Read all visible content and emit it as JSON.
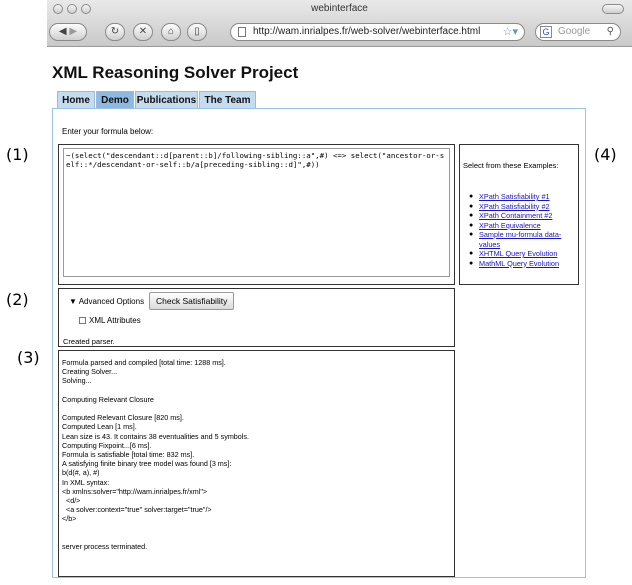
{
  "browser": {
    "window_title": "webinterface",
    "url": "http://wam.inrialpes.fr/web-solver/webinterface.html",
    "search_placeholder": "Google",
    "icons": [
      "back-icon",
      "forward-icon",
      "reload-icon",
      "stop-icon",
      "home-icon",
      "page-icon",
      "bookmark-star-icon",
      "search-engine-icon",
      "magnifier-icon",
      "extension-icon"
    ]
  },
  "page": {
    "title": "XML Reasoning Solver Project",
    "tabs": [
      {
        "label": "Home",
        "active": false
      },
      {
        "label": "Demo",
        "active": true
      },
      {
        "label": "Publications",
        "active": false
      },
      {
        "label": "The Team",
        "active": false
      }
    ]
  },
  "formula": {
    "prompt": "Enter your formula below:",
    "value": "~(select(\"descendant::d[parent::b]/following-sibling::a\",#) <=> select(\"ancestor-or-self::*/descendant-or-self::b/a[preceding-sibling::d]\",#))"
  },
  "examples": {
    "heading": "Select from these Examples:",
    "items": [
      "XPath Satisfiability #1",
      "XPath Satisfiability #2",
      "XPath Containment #2",
      "XPath Equivalence",
      "Sample mu-formula data-values",
      "XHTML Query Evolution",
      "MathML Query Evolution"
    ]
  },
  "controls": {
    "advanced_label": "Advanced Options",
    "check_button": "Check Satisfiability",
    "xml_attributes_label": "XML Attributes",
    "status": "Created parser."
  },
  "output": {
    "lines": [
      "Formula parsed and compiled [total time: 1288 ms].",
      "Creating Solver...",
      "Solving...",
      "",
      "Computing Relevant Closure",
      "",
      "Computed Relevant Closure [820 ms].",
      "Computed Lean [1 ms].",
      "Lean size is 43. It contains 38 eventualities and 5 symbols.",
      "Computing Fixpoint...[6 ms].",
      "Formula is satisfiable [total time: 832 ms].",
      "A satisfying finite binary tree model was found [3 ms]:",
      "b(d(#, a), #)",
      "In XML syntax:",
      "<b xmlns:solver=\"http://wam.inrialpes.fr/xml\">",
      "  <d/>",
      "  <a solver:context=\"true\" solver:target=\"true\"/>",
      "</b>",
      "",
      "",
      "server process terminated."
    ]
  },
  "callouts": [
    "(1)",
    "(2)",
    "(3)",
    "(4)"
  ]
}
